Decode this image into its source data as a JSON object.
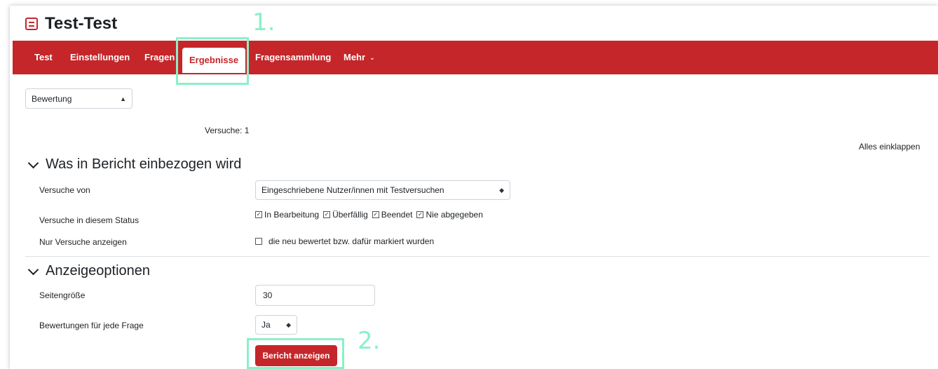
{
  "header": {
    "title": "Test-Test"
  },
  "annotations": {
    "step1": "1.",
    "step2": "2."
  },
  "nav": {
    "items": [
      "Test",
      "Einstellungen",
      "Fragen",
      "Ergebnisse",
      "Fragensammlung",
      "Mehr"
    ],
    "active": "Ergebnisse"
  },
  "report_select": {
    "value": "Bewertung"
  },
  "attempts": {
    "label": "Versuche: 1"
  },
  "collapse_all": "Alles einklappen",
  "section_include": {
    "title": "Was in Bericht einbezogen wird",
    "attempts_from": {
      "label": "Versuche von",
      "value": "Eingeschriebene Nutzer/innen mit Testversuchen"
    },
    "status": {
      "label": "Versuche in diesem Status",
      "options": [
        {
          "label": "In Bearbeitung",
          "checked": true
        },
        {
          "label": "Überfällig",
          "checked": true
        },
        {
          "label": "Beendet",
          "checked": true
        },
        {
          "label": "Nie abgegeben",
          "checked": true
        }
      ]
    },
    "only_attempts": {
      "label": "Nur Versuche anzeigen",
      "option": "die neu bewertet bzw. dafür markiert wurden",
      "checked": false
    }
  },
  "section_display": {
    "title": "Anzeigeoptionen",
    "page_size": {
      "label": "Seitengröße",
      "value": "30"
    },
    "grades_per_question": {
      "label": "Bewertungen für jede Frage",
      "value": "Ja"
    },
    "submit": "Bericht anzeigen"
  }
}
